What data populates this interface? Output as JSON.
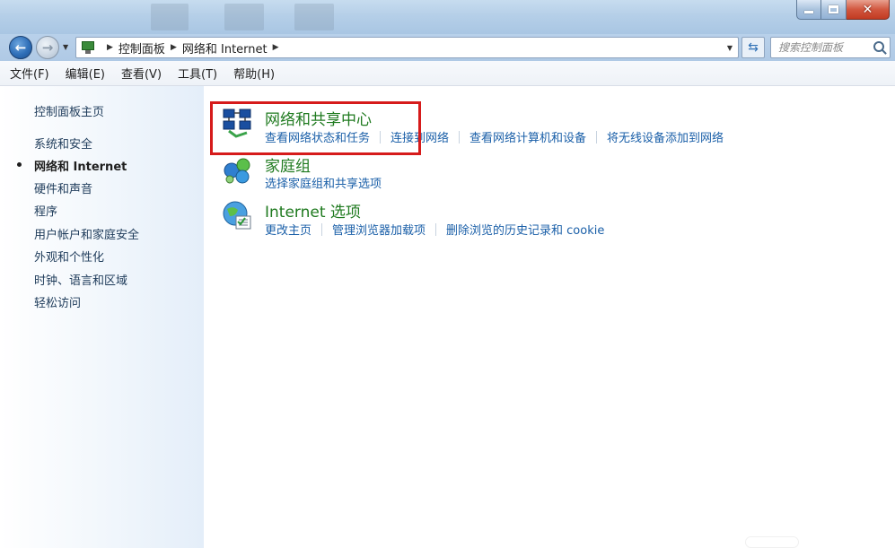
{
  "address_bar": {
    "crumbs": [
      "控制面板",
      "网络和 Internet"
    ],
    "search_placeholder": "搜索控制面板"
  },
  "menu": [
    "文件(F)",
    "编辑(E)",
    "查看(V)",
    "工具(T)",
    "帮助(H)"
  ],
  "sidebar": {
    "home": "控制面板主页",
    "items": [
      "系统和安全",
      "网络和 Internet",
      "硬件和声音",
      "程序",
      "用户帐户和家庭安全",
      "外观和个性化",
      "时钟、语言和区域",
      "轻松访问"
    ],
    "active_index": 1
  },
  "categories": [
    {
      "title": "网络和共享中心",
      "icon": "network-sharing-center-icon",
      "links": [
        "查看网络状态和任务",
        "连接到网络",
        "查看网络计算机和设备",
        "将无线设备添加到网络"
      ]
    },
    {
      "title": "家庭组",
      "icon": "homegroup-icon",
      "links": [
        "选择家庭组和共享选项"
      ]
    },
    {
      "title": "Internet 选项",
      "icon": "internet-options-icon",
      "links": [
        "更改主页",
        "管理浏览器加载项",
        "删除浏览的历史记录和 cookie"
      ]
    }
  ],
  "colors": {
    "accent_link": "#1a5fa8",
    "category_title": "#1f7a1f",
    "highlight": "#d61b1b"
  }
}
